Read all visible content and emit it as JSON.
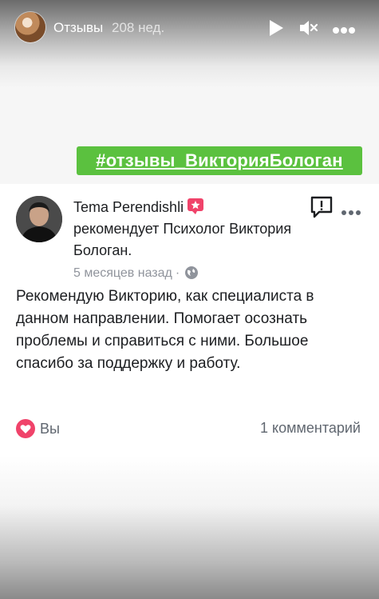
{
  "story": {
    "title": "Отзывы",
    "time": "208 нед."
  },
  "hashtag": "#отзывы_ВикторияБологан",
  "post": {
    "author_name": "Tema Perendishli",
    "recommends": "рекомендует Психолог Виктория Бологан.",
    "time_ago": "5 месяцев назад",
    "separator": "·",
    "text": "Рекомендую Викторию, как специалиста в данном направлении. Помогает осознать проблемы и справиться с ними. Большое спасибо за поддержку и работу.",
    "reaction_label": "Вы",
    "comments_label": "1 комментарий"
  },
  "colors": {
    "hashtag_bg": "#5bc13f",
    "recommend_badge": "#f0436a",
    "heart": "#f0436a"
  },
  "icons": {
    "play": "play-icon",
    "mute": "mute-icon",
    "more": "more-icon",
    "report": "report-icon",
    "globe": "globe-icon",
    "heart": "heart-icon"
  }
}
